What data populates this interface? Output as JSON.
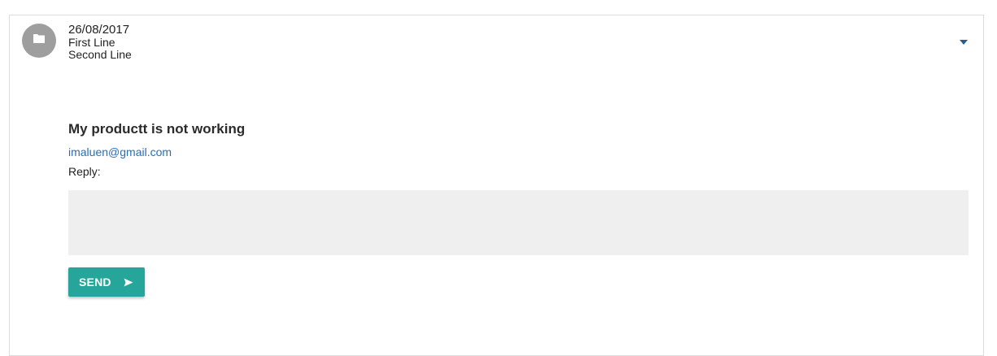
{
  "item": {
    "avatar_icon": "folder-icon",
    "date": "26/08/2017",
    "first_line": "First Line",
    "second_line": "Second Line",
    "expand_icon": "caret-down-icon"
  },
  "message": {
    "subject": "My productt is not working",
    "email": "imaluen@gmail.com",
    "reply_label": "Reply:",
    "reply_value": ""
  },
  "send_button": {
    "label": "SEND",
    "icon": "send-icon",
    "color": "#26a69a"
  },
  "colors": {
    "avatar": "#9e9e9e",
    "link": "#2a6db3",
    "reply_box": "#efefef",
    "caret": "#2a5d8f"
  }
}
